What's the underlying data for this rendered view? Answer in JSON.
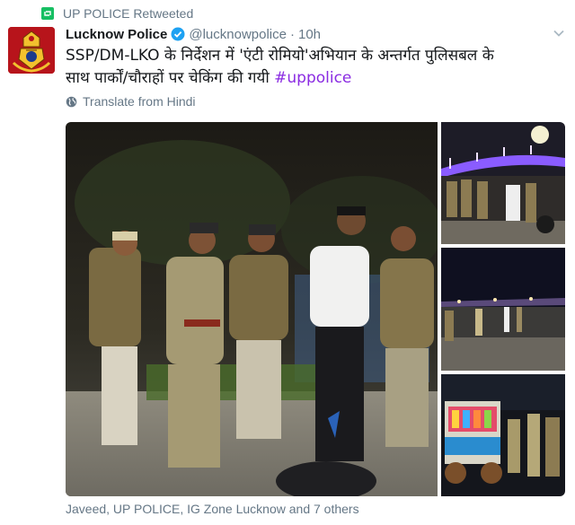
{
  "retweet_context": {
    "label": "UP POLICE Retweeted"
  },
  "tweet": {
    "author_name": "Lucknow Police",
    "handle": "@lucknowpolice",
    "separator": "·",
    "time": "10h",
    "text_line1": "SSP/DM-LKO के निर्देशन में 'एंटी रोमियो'अभियान के अन्तर्गत पुलिसबल के",
    "text_line2": "साथ पार्कों/चौराहों पर चेकिंग की गयी",
    "hashtag": "#uppolice",
    "translate_label": "Translate from Hindi"
  },
  "media": {
    "photos": [
      {
        "name": "main-photo",
        "icon": "police-officers-night-photo"
      },
      {
        "name": "thumb-1",
        "icon": "illuminated-bridge-photo"
      },
      {
        "name": "thumb-2",
        "icon": "riverfront-night-photo"
      },
      {
        "name": "thumb-3",
        "icon": "food-cart-night-photo"
      }
    ]
  },
  "retweeters": {
    "label": "Javeed, UP POLICE, IG Zone Lucknow and 7 others"
  },
  "colors": {
    "retweet_green": "#17bf63",
    "verified_blue": "#1da1f2",
    "hashtag_purple": "#8a2be2",
    "meta_grey": "#657786",
    "avatar_red": "#b7141b"
  }
}
